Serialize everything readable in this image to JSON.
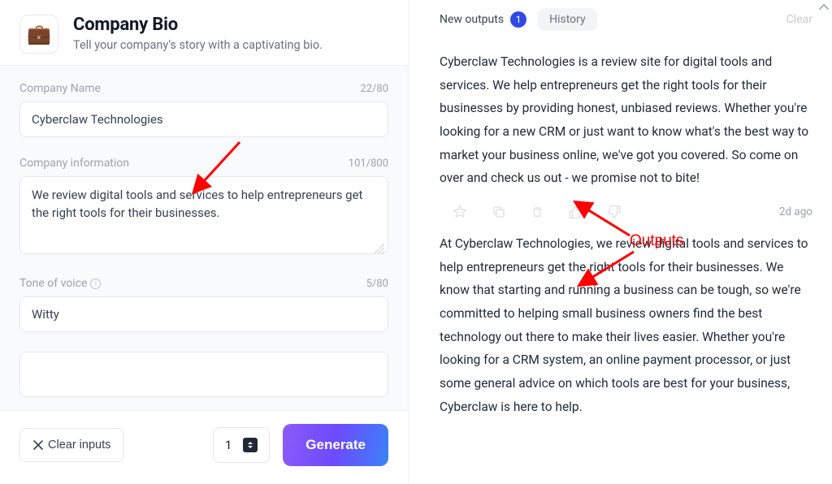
{
  "header": {
    "icon": "💼",
    "title": "Company Bio",
    "subtitle": "Tell your company's story with a captivating bio."
  },
  "fields": {
    "company_name": {
      "label": "Company Name",
      "value": "Cyberclaw Technologies",
      "count": "22/80"
    },
    "company_info": {
      "label": "Company information",
      "value": "We review digital tools and services to help entrepreneurs get the right tools for their businesses.",
      "count": "101/800"
    },
    "tone": {
      "label": "Tone of voice",
      "value": "Witty",
      "count": "5/80"
    }
  },
  "bottom": {
    "clear_label": "Clear inputs",
    "count_value": "1",
    "generate_label": "Generate"
  },
  "right": {
    "new_outputs_label": "New outputs",
    "badge": "1",
    "history_label": "History",
    "clear_label": "Clear",
    "timestamp": "2d ago",
    "outputs": {
      "0": "Cyberclaw Technologies is a review site for digital tools and services. We help entrepreneurs get the right tools for their businesses by providing honest, unbiased reviews. Whether you're looking for a new CRM or just want to know what's the best way to market your business online, we've got you covered. So come on over and check us out - we promise not to bite!",
      "1": "At Cyberclaw Technologies, we review digital tools and services to help entrepreneurs get the right tools for their businesses. We know that starting and running a business can be tough, so we're committed to helping small business owners find the best technology out there to make their lives easier. Whether you're looking for a CRM system, an online payment processor, or just some general advice on which tools are best for your business, Cyberclaw is here to help."
    }
  },
  "annotation": {
    "label": "Outputs"
  }
}
